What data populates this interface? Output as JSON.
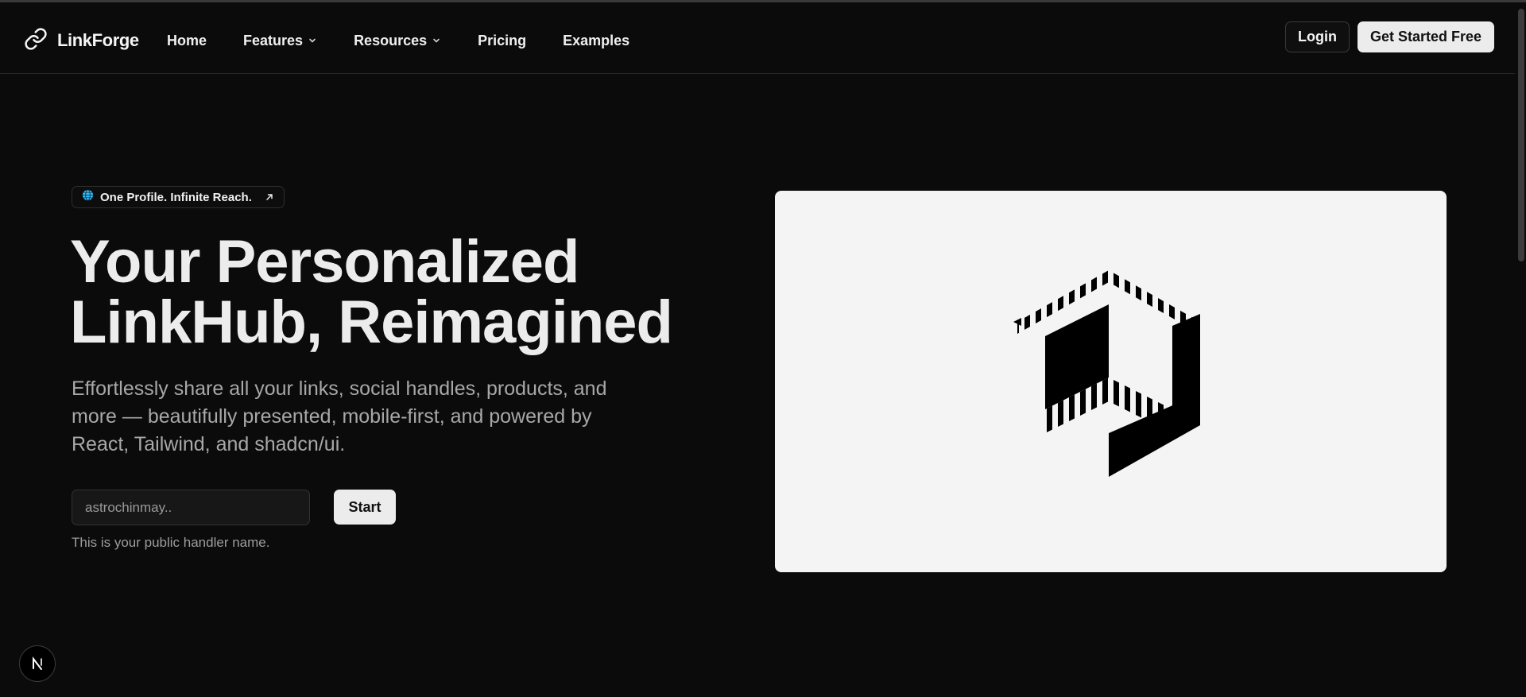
{
  "brand": {
    "name": "LinkForge",
    "icon": "link-icon"
  },
  "nav": {
    "items": [
      {
        "label": "Home",
        "has_dropdown": false
      },
      {
        "label": "Features",
        "has_dropdown": true
      },
      {
        "label": "Resources",
        "has_dropdown": true
      },
      {
        "label": "Pricing",
        "has_dropdown": false
      },
      {
        "label": "Examples",
        "has_dropdown": false
      }
    ],
    "login_label": "Login",
    "cta_label": "Get Started Free"
  },
  "hero": {
    "badge": {
      "text": "One Profile. Infinite Reach.",
      "icon_left": "globe-icon",
      "icon_right": "arrow-up-right-icon"
    },
    "headline_line1": "Your Personalized",
    "headline_line2": "LinkHub, Reimagined",
    "subtext": "Effortlessly share all your links, social handles, products, and more — beautifully presented, mobile-first, and powered by React, Tailwind, and shadcn/ui.",
    "input_placeholder": "astrochinmay..",
    "start_label": "Start",
    "helper_text": "This is your public handler name."
  },
  "illustration": {
    "icon": "striped-cube-logo-icon"
  },
  "dev_badge": {
    "icon": "nextjs-icon",
    "text": "N"
  },
  "colors": {
    "background": "#0b0b0b",
    "text": "#ececec",
    "muted": "#a8a8a8",
    "button_light": "#ececec",
    "card": "#f4f4f4",
    "globe_accent": "#38bdf8"
  }
}
